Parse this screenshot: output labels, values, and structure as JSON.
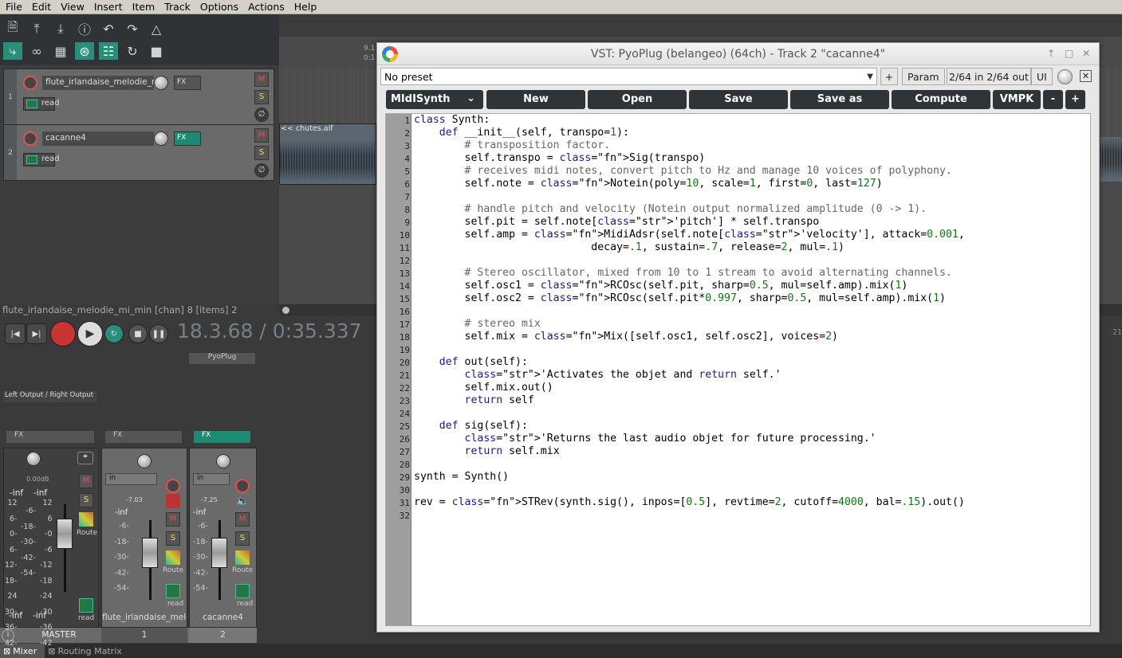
{
  "menu": [
    "File",
    "Edit",
    "View",
    "Insert",
    "Item",
    "Track",
    "Options",
    "Actions",
    "Help"
  ],
  "toolbar": {
    "row1_icons": [
      "new-project-icon",
      "open-project-icon",
      "save-project-icon",
      "info-icon",
      "undo-icon",
      "redo-icon",
      "metronome-icon"
    ],
    "row2_icons": [
      "ripple-edit-icon",
      "link-icon",
      "grid-icon",
      "snap-icon",
      "grid-lines-icon",
      "loop-icon",
      "lock-icon"
    ]
  },
  "tracks": [
    {
      "number": "1",
      "name": "flute_irlandaise_melodie_m",
      "fx": "FX",
      "automation": "read"
    },
    {
      "number": "2",
      "name": "cacanne4",
      "fx": "FX",
      "automation": "read"
    }
  ],
  "ruler": {
    "mark1": "9.1",
    "mark2": "0:1"
  },
  "item": {
    "label": "<< chutes.aif"
  },
  "status": "flute_irlandaise_melodie_mi_min [chan] 8 [items] 2",
  "transport": {
    "time": "18.3.68 / 0:35.337"
  },
  "right_edge_label": "21",
  "mixer": {
    "plugin_slot": "PyoPlug",
    "master_output": "Left Output / Right Output",
    "master": {
      "fx": "FX",
      "db": "0.00dB",
      "peakL": "-inf",
      "peakR": "-inf",
      "bottomL": "-inf",
      "bottomR": "-inf",
      "name": "MASTER",
      "route": "Route",
      "auto": "read"
    },
    "strip1": {
      "fx": "FX",
      "input": "in",
      "db": "-7.03",
      "peak": "-inf",
      "route": "Route",
      "auto": "read",
      "name": "flute_irlandaise_melodie_mi_min",
      "num": "1"
    },
    "strip2": {
      "fx": "FX",
      "input": "in",
      "db": "-7.25",
      "peak": "-inf",
      "route": "Route",
      "auto": "read",
      "name": "cacanne4",
      "num": "2"
    },
    "scale_left": [
      "12",
      "6-",
      "0-",
      "6-",
      "12-",
      "18-",
      "24",
      "30-",
      "36-",
      "42-"
    ],
    "scale_mid": [
      "-6-",
      "-18-",
      "-30-",
      "-42-",
      "-54-"
    ],
    "scale_right": [
      "12",
      "6",
      "-0",
      "-6",
      "-12",
      "-18",
      "-24",
      "-30",
      "-36",
      "-42"
    ],
    "strip_scale": [
      "-6-",
      "-18-",
      "-30-",
      "-42-",
      "-54-"
    ]
  },
  "bottom_tabs": [
    "Mixer",
    "Routing Matrix"
  ],
  "vst": {
    "title": "VST: PyoPlug (belangeo) (64ch) - Track 2 \"cacanne4\"",
    "preset": "No preset",
    "plus": "+",
    "param": "Param",
    "io": "2/64 in 2/64 out",
    "ui": "UI",
    "synth_select": "MIdISynth",
    "buttons": [
      "New",
      "Open",
      "Save",
      "Save as",
      "Compute",
      "VMPK",
      "-",
      "+"
    ]
  },
  "code": [
    "class Synth:",
    "    def __init__(self, transpo=1):",
    "        # transposition factor.",
    "        self.transpo = Sig(transpo)",
    "        # receives midi notes, convert pitch to Hz and manage 10 voices of polyphony.",
    "        self.note = Notein(poly=10, scale=1, first=0, last=127)",
    "",
    "        # handle pitch and velocity (Notein output normalized amplitude (0 -> 1).",
    "        self.pit = self.note['pitch'] * self.transpo",
    "        self.amp = MidiAdsr(self.note['velocity'], attack=0.001,",
    "                            decay=.1, sustain=.7, release=2, mul=.1)",
    "",
    "        # Stereo oscillator, mixed from 10 to 1 stream to avoid alternating channels.",
    "        self.osc1 = RCOsc(self.pit, sharp=0.5, mul=self.amp).mix(1)",
    "        self.osc2 = RCOsc(self.pit*0.997, sharp=0.5, mul=self.amp).mix(1)",
    "",
    "        # stereo mix",
    "        self.mix = Mix([self.osc1, self.osc2], voices=2)",
    "",
    "    def out(self):",
    "        'Activates the objet and return self.'",
    "        self.mix.out()",
    "        return self",
    "",
    "    def sig(self):",
    "        'Returns the last audio objet for future processing.'",
    "        return self.mix",
    "",
    "synth = Synth()",
    "",
    "rev = STRev(synth.sig(), inpos=[0.5], revtime=2, cutoff=4000, bal=.15).out()",
    ""
  ]
}
